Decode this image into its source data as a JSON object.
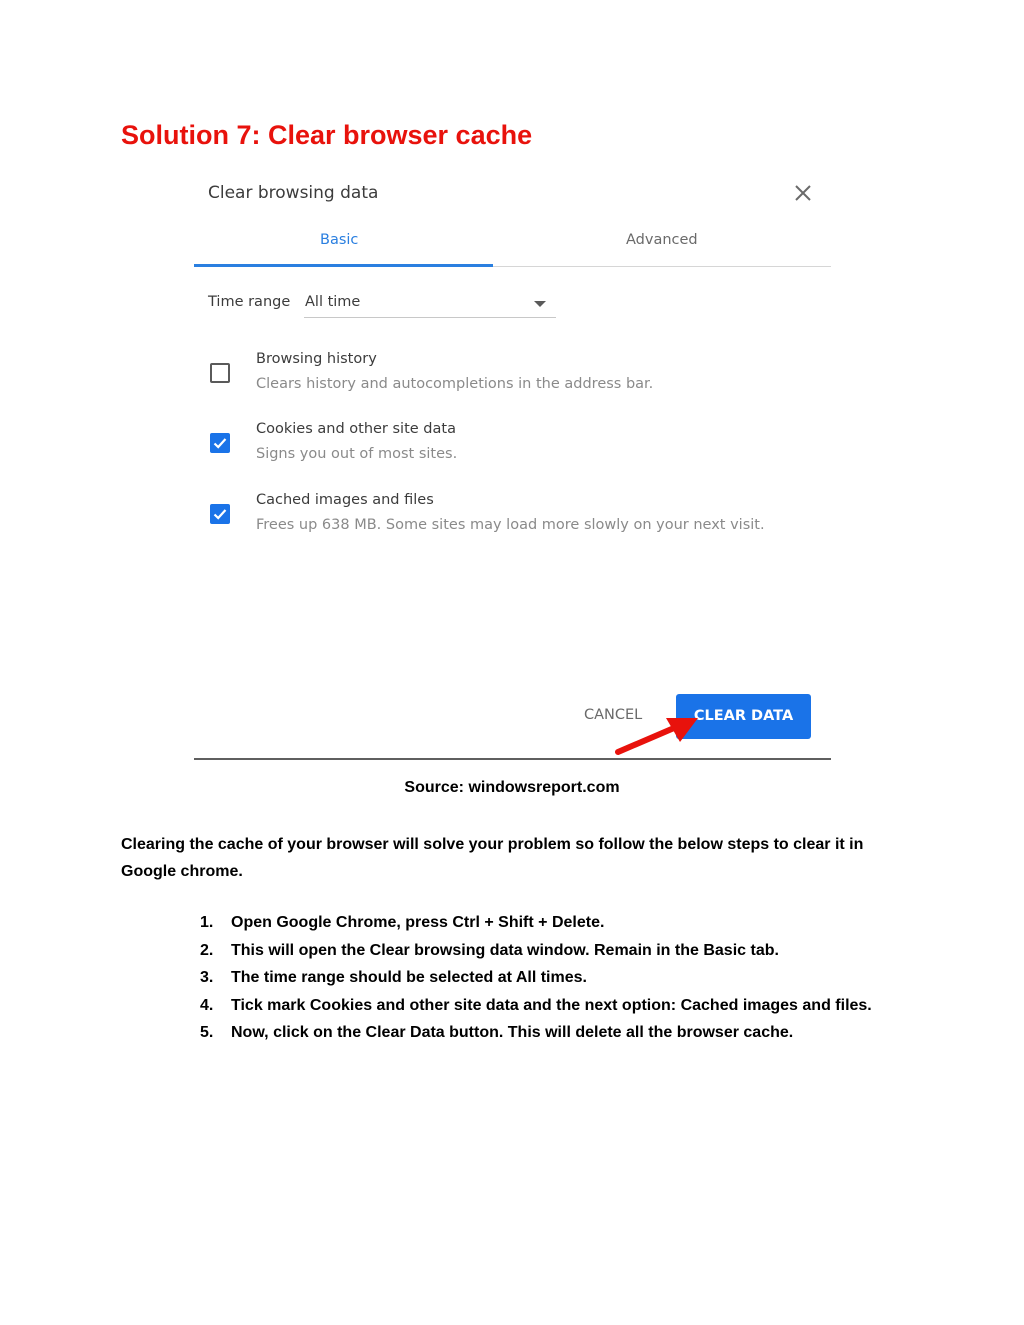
{
  "heading": "Solution 7: Clear browser cache",
  "dialog": {
    "title": "Clear browsing data",
    "tabs": {
      "basic": "Basic",
      "advanced": "Advanced"
    },
    "time_range": {
      "label": "Time range",
      "value": "All time"
    },
    "options": [
      {
        "title": "Browsing history",
        "description": "Clears history and autocompletions in the address bar.",
        "checked": false
      },
      {
        "title": "Cookies and other site data",
        "description": "Signs you out of most sites.",
        "checked": true
      },
      {
        "title": "Cached images and files",
        "description": "Frees up 638 MB. Some sites may load more slowly on your next visit.",
        "checked": true
      }
    ],
    "cancel_label": "CANCEL",
    "clear_label": "CLEAR DATA",
    "accent_color": "#1a73e8",
    "arrow_color": "#e8120c"
  },
  "caption": "Source: windowsreport.com",
  "paragraph": "Clearing the cache of your browser will solve your problem so follow the below steps to clear it in Google chrome.",
  "steps": [
    {
      "num": "1.",
      "text": "Open Google Chrome, press Ctrl + Shift + Delete."
    },
    {
      "num": "2.",
      "text": "This will open the Clear browsing data window. Remain in the Basic tab."
    },
    {
      "num": "3.",
      "text": "The time range should be selected at All times."
    },
    {
      "num": "4.",
      "text": "Tick mark Cookies and other site data and the next option: Cached images and files."
    },
    {
      "num": "5.",
      "text": "Now, click on the Clear Data button. This will delete all the browser cache."
    }
  ]
}
